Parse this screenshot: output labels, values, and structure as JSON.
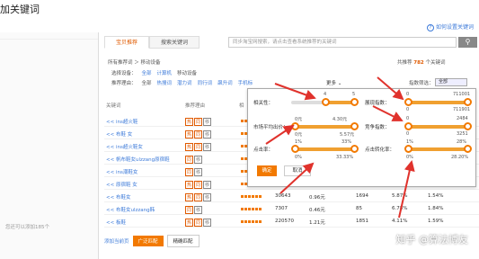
{
  "window": {
    "title": "加关键词"
  },
  "help": {
    "label": "如何设置关键词"
  },
  "left": {
    "count": "您还可以添加185个"
  },
  "tabs": [
    {
      "label": "宝贝推荐"
    },
    {
      "label": "搜索关键词"
    }
  ],
  "search": {
    "placeholder": "同步淘宝网搜索，请点击查看系统推荐的关键词"
  },
  "crumb": {
    "text": "所有推荐词 ＞ 移动设备"
  },
  "total": {
    "prefix": "共推荐",
    "count": "782",
    "suffix": "个关键词"
  },
  "filter_device": {
    "label": "选择设备：",
    "options": [
      "全部",
      "计算机",
      "移动设备"
    ]
  },
  "filter_reason": {
    "label": "推荐理由：",
    "options": [
      "全部",
      "热搜词",
      "潜力词",
      "同行词",
      "飙升词",
      "手机标"
    ]
  },
  "more": {
    "label": "更多"
  },
  "index_filter": {
    "label": "指数筛选：",
    "value": "全部"
  },
  "table_header": {
    "keyword": "关键词",
    "reason": "推荐理由",
    "relevance": "相"
  },
  "rows": [
    {
      "kw": "<< ins超火鞋",
      "icons": [
        "热",
        "同",
        "移"
      ],
      "v1": "",
      "v2": "",
      "v3": "",
      "v4": "",
      "v5": ""
    },
    {
      "kw": "<< 布鞋 女",
      "icons": [
        "热",
        "同",
        "移"
      ],
      "v1": "",
      "v2": "",
      "v3": "",
      "v4": "",
      "v5": ""
    },
    {
      "kw": "<< ins超火鞋女",
      "icons": [
        "热",
        "同",
        "移"
      ],
      "v1": "",
      "v2": "",
      "v3": "",
      "v4": "",
      "v5": ""
    },
    {
      "kw": "<< 帆布鞋女ulzzang原宿鞋",
      "icons": [
        "同",
        "移"
      ],
      "v1": "",
      "v2": "",
      "v3": "",
      "v4": "",
      "v5": ""
    },
    {
      "kw": "<< ins潮鞋女",
      "icons": [
        "同",
        "移"
      ],
      "v1": "",
      "v2": "",
      "v3": "",
      "v4": "",
      "v5": ""
    },
    {
      "kw": "<< 原宿鞋 女",
      "icons": [
        "热",
        "同",
        "移"
      ],
      "v1": "48902",
      "v2": "0.56元",
      "v3": "760",
      "v4": "5.04%",
      "v5": "1.13%"
    },
    {
      "kw": "<< 布鞋女",
      "icons": [
        "热",
        "同",
        "移"
      ],
      "v1": "30643",
      "v2": "0.96元",
      "v3": "1694",
      "v4": "5.87%",
      "v5": "1.54%"
    },
    {
      "kw": "<< 布鞋女ulzzang韩",
      "icons": [
        "同",
        "移"
      ],
      "v1": "7307",
      "v2": "0.46元",
      "v3": "85",
      "v4": "6.78%",
      "v5": "1.84%"
    },
    {
      "kw": "<< 板鞋",
      "icons": [
        "热",
        "同",
        "移"
      ],
      "v1": "220570",
      "v2": "1.21元",
      "v3": "1851",
      "v4": "4.11%",
      "v5": "1.59%"
    }
  ],
  "bottom": {
    "add_page": "添加当前页",
    "btn_broad": "广泛匹配",
    "btn_exact": "精确匹配"
  },
  "popup": {
    "relevance": {
      "label": "相关性：",
      "min": "4",
      "max": "5"
    },
    "show_index": {
      "label": "展现指数：",
      "min": "0",
      "max": "711001",
      "val_low": "0",
      "val_high": "711901"
    },
    "avg_bid": {
      "label": "市场平均出价：",
      "min": "0元",
      "max": "4.30元",
      "val_low": "0元",
      "val_high": "5.57元"
    },
    "competition": {
      "label": "竞争指数：",
      "min": "0",
      "max": "2484",
      "val_low": "0",
      "val_high": "3251"
    },
    "ctr": {
      "label": "点击率：",
      "min": "1%",
      "max": "33%",
      "val_low": "0%",
      "val_high": "33.33%"
    },
    "cvr": {
      "label": "点击转化率：",
      "min": "1%",
      "max": "28%",
      "val_low": "0%",
      "val_high": "28.20%"
    },
    "ok": "确定",
    "cancel": "取消"
  },
  "watermark": "知乎 @算法博友",
  "colors": {
    "accent": "#f27900",
    "link": "#3c7ad9",
    "arrow": "#e0322c"
  }
}
